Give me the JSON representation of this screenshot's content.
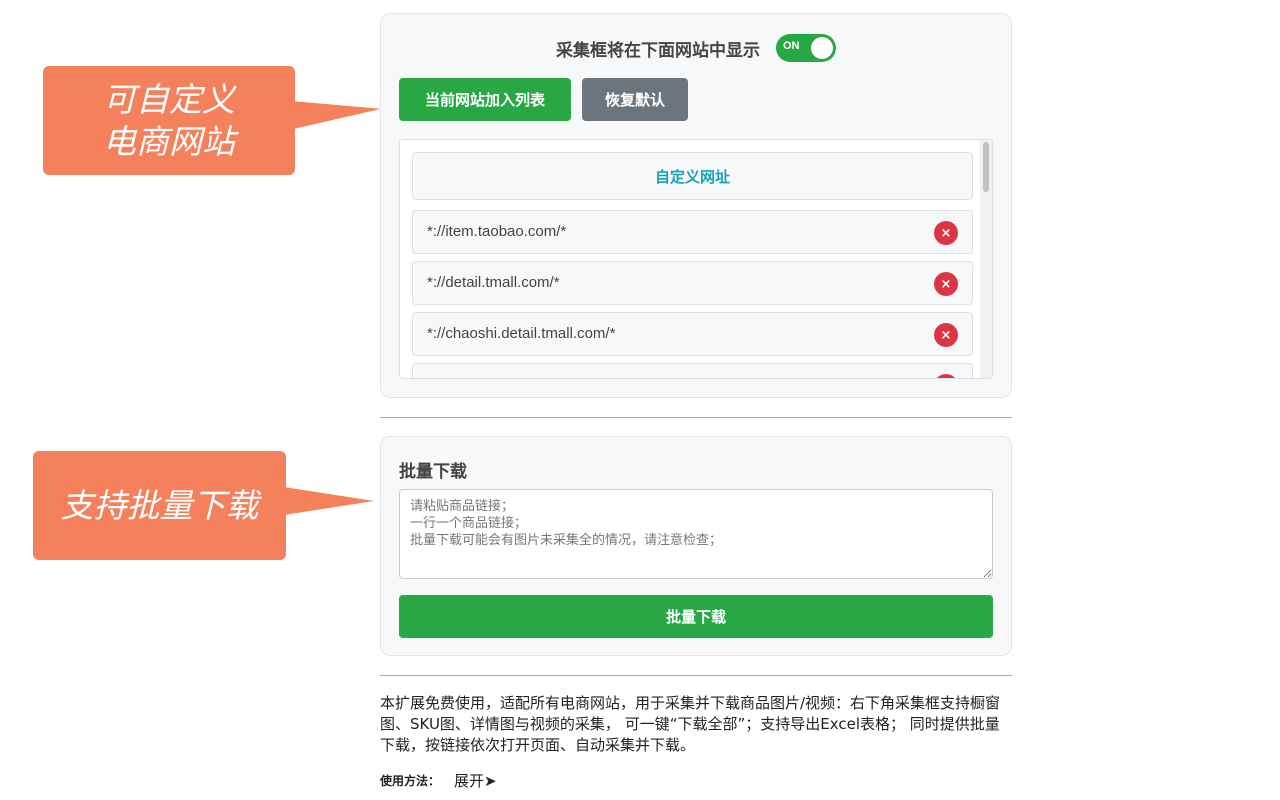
{
  "callouts": {
    "custom_sites": "可自定义\n电商网站",
    "batch": "支持批量下载"
  },
  "site_panel": {
    "toggle_title": "采集框将在下面网站中显示",
    "toggle_state": "ON",
    "add_site_label": "当前网站加入列表",
    "reset_label": "恢复默认",
    "list_header": "自定义网址",
    "urls": [
      "*://item.taobao.com/*",
      "*://detail.tmall.com/*",
      "*://chaoshi.detail.tmall.com/*"
    ],
    "delete_symbol": "×"
  },
  "batch_panel": {
    "title": "批量下载",
    "placeholder": "请粘贴商品链接；\n一行一个商品链接；\n批量下载可能会有图片未采集全的情况，请注意检查；",
    "button_label": "批量下载"
  },
  "footer": {
    "description": "本扩展免费使用，适配所有电商网站，用于采集并下载商品图片/视频：右下角采集框支持橱窗图、SKU图、详情图与视频的采集， 可一键“下载全部”；支持导出Excel表格； 同时提供批量下载，按链接依次打开页面、自动采集并下载。",
    "usage_label": "使用方法：",
    "expand_label": "展开➤"
  },
  "colors": {
    "primary_green": "#28a745",
    "secondary_gray": "#6c757d",
    "danger_red": "#dc3545",
    "callout_orange": "#f5805c",
    "link_teal": "#17a2b8"
  }
}
